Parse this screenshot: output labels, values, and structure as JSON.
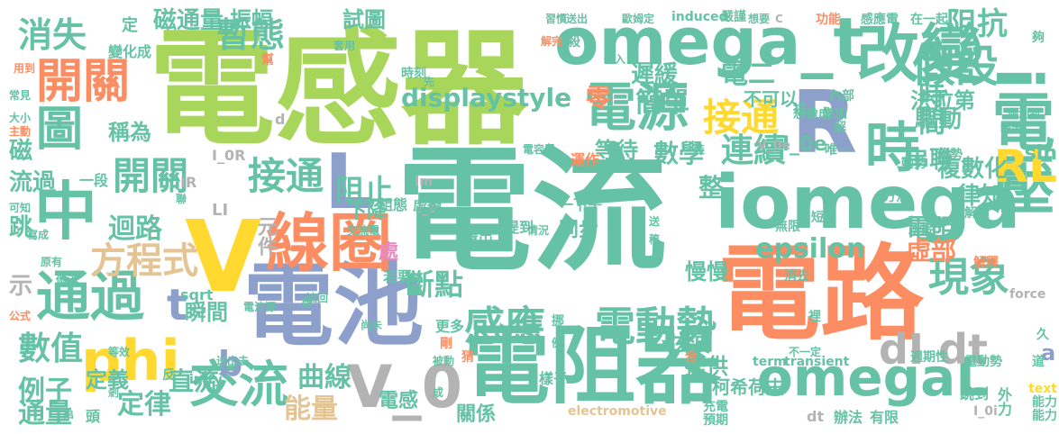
{
  "palette": {
    "green": "#a7d65a",
    "teal": "#66c2a5",
    "orange": "#fc8d62",
    "blue": "#8da0cb",
    "yellow": "#ffd92f",
    "tan": "#e5c494",
    "gray": "#b3b3b3",
    "pink": "#e78ac3"
  },
  "words": [
    {
      "text": "電感器",
      "color": "green"
    },
    {
      "text": "電流",
      "color": "teal"
    },
    {
      "text": "電路",
      "color": "orange"
    },
    {
      "text": "電池",
      "color": "blue"
    },
    {
      "text": "電阻器",
      "color": "teal"
    },
    {
      "text": "omega_t",
      "color": "teal"
    },
    {
      "text": "R",
      "color": "blue"
    },
    {
      "text": "V",
      "color": "yellow"
    },
    {
      "text": "iomega",
      "color": "teal"
    },
    {
      "text": "中",
      "color": "teal"
    },
    {
      "text": "線圈",
      "color": "orange"
    },
    {
      "text": "改變",
      "color": "teal"
    },
    {
      "text": "電源",
      "color": "teal"
    },
    {
      "text": "開關",
      "color": "orange"
    },
    {
      "text": "圖",
      "color": "teal"
    },
    {
      "text": "i電壓",
      "color": "teal"
    },
    {
      "text": "假設",
      "color": "teal"
    },
    {
      "text": "時",
      "color": "teal"
    },
    {
      "text": "omegaL",
      "color": "teal"
    },
    {
      "text": "V_0",
      "color": "gray"
    },
    {
      "text": "phi",
      "color": "yellow"
    },
    {
      "text": "通過",
      "color": "teal"
    },
    {
      "text": "交流",
      "color": "teal"
    },
    {
      "text": "感應",
      "color": "teal"
    },
    {
      "text": "電動勢",
      "color": "teal"
    },
    {
      "text": "現象",
      "color": "teal"
    },
    {
      "text": "開關",
      "color": "teal"
    },
    {
      "text": "接通",
      "color": "teal"
    },
    {
      "text": "接通",
      "color": "yellow"
    },
    {
      "text": "L",
      "color": "blue"
    },
    {
      "text": "方程式",
      "color": "tan"
    },
    {
      "text": "displaystyle",
      "color": "teal"
    },
    {
      "text": "暫態",
      "color": "teal"
    },
    {
      "text": "消失",
      "color": "teal"
    },
    {
      "text": "磁通量",
      "color": "teal"
    },
    {
      "text": "epsilon",
      "color": "teal"
    },
    {
      "text": "dI dt",
      "color": "gray"
    },
    {
      "text": "RL",
      "color": "yellow"
    },
    {
      "text": "阻抗",
      "color": "teal"
    },
    {
      "text": "數值",
      "color": "teal"
    },
    {
      "text": "例子",
      "color": "teal"
    },
    {
      "text": "定律",
      "color": "teal"
    },
    {
      "text": "曲線",
      "color": "teal"
    },
    {
      "text": "能量",
      "color": "tan"
    },
    {
      "text": "通量",
      "color": "teal"
    },
    {
      "text": "迴路",
      "color": "teal"
    },
    {
      "text": "阻止",
      "color": "teal"
    },
    {
      "text": "t",
      "color": "blue"
    },
    {
      "text": "b",
      "color": "blue"
    },
    {
      "text": "斷點",
      "color": "teal"
    },
    {
      "text": "連續",
      "color": "teal"
    },
    {
      "text": "時間",
      "color": "teal"
    },
    {
      "text": "電阻",
      "color": "teal"
    },
    {
      "text": "虛部",
      "color": "orange"
    },
    {
      "text": "串聯",
      "color": "teal"
    },
    {
      "text": "律知",
      "color": "teal"
    },
    {
      "text": "複數化",
      "color": "teal"
    },
    {
      "text": "簡單",
      "color": "teal"
    },
    {
      "text": "遲緩",
      "color": "teal"
    },
    {
      "text": "驅動",
      "color": "teal"
    },
    {
      "text": "法拉第",
      "color": "teal"
    },
    {
      "text": "數學",
      "color": "teal"
    },
    {
      "text": "等待",
      "color": "teal"
    },
    {
      "text": "慢慢",
      "color": "teal"
    },
    {
      "text": "弦波",
      "color": "teal"
    },
    {
      "text": "提供",
      "color": "teal"
    },
    {
      "text": "柯希荷夫",
      "color": "teal"
    },
    {
      "text": "關係",
      "color": "teal"
    },
    {
      "text": "直流",
      "color": "teal"
    },
    {
      "text": "瞬間",
      "color": "teal"
    },
    {
      "text": "定義",
      "color": "teal"
    },
    {
      "text": "振幅",
      "color": "teal"
    },
    {
      "text": "試圖",
      "color": "teal"
    },
    {
      "text": "整",
      "color": "teal"
    },
    {
      "text": "sin",
      "color": "teal"
    },
    {
      "text": "I_0e",
      "color": "teal"
    },
    {
      "text": "同步",
      "color": "teal"
    },
    {
      "text": "電感",
      "color": "teal"
    },
    {
      "text": "下降",
      "color": "teal"
    },
    {
      "text": "元件",
      "color": "gray"
    },
    {
      "text": "處",
      "color": "pink"
    },
    {
      "text": "電二",
      "color": "teal"
    },
    {
      "text": "不可以",
      "color": "teal"
    },
    {
      "text": "零",
      "color": "orange"
    },
    {
      "text": "sqrt",
      "color": "teal"
    },
    {
      "text": "infty",
      "color": "teal"
    },
    {
      "text": "transient",
      "color": "teal"
    },
    {
      "text": "term",
      "color": "teal"
    },
    {
      "text": "electromotive",
      "color": "tan"
    },
    {
      "text": "force",
      "color": "gray"
    },
    {
      "text": "induced",
      "color": "teal"
    },
    {
      "text": "嚴謹",
      "color": "teal"
    },
    {
      "text": "text",
      "color": "yellow"
    },
    {
      "text": "I_0R",
      "color": "gray"
    },
    {
      "text": "I_0i",
      "color": "gray"
    },
    {
      "text": "V_0e",
      "color": "gray"
    },
    {
      "text": "LI",
      "color": "gray"
    },
    {
      "text": "IR",
      "color": "gray"
    },
    {
      "text": "Im",
      "color": "gray"
    },
    {
      "text": "I_0",
      "color": "gray"
    },
    {
      "text": "dt",
      "color": "gray"
    },
    {
      "text": "a",
      "color": "blue"
    },
    {
      "text": "d",
      "color": "gray"
    },
    {
      "text": "變化成",
      "color": "teal"
    },
    {
      "text": "稱為",
      "color": "teal"
    },
    {
      "text": "磁",
      "color": "teal"
    },
    {
      "text": "流過",
      "color": "teal"
    },
    {
      "text": "跳",
      "color": "teal"
    },
    {
      "text": "示",
      "color": "gray"
    },
    {
      "text": "頭",
      "color": "teal"
    },
    {
      "text": "一段",
      "color": "teal"
    },
    {
      "text": "組態",
      "color": "teal"
    },
    {
      "text": "虛擬",
      "color": "teal"
    },
    {
      "text": "提到",
      "color": "teal"
    },
    {
      "text": "運作",
      "color": "orange"
    },
    {
      "text": "一下子",
      "color": "teal"
    },
    {
      "text": "畫出",
      "color": "teal"
    },
    {
      "text": "若要",
      "color": "teal"
    },
    {
      "text": "更多",
      "color": "teal"
    },
    {
      "text": "樣子",
      "color": "teal"
    },
    {
      "text": "充電",
      "color": "teal"
    },
    {
      "text": "預期",
      "color": "teal"
    },
    {
      "text": "辦法",
      "color": "teal"
    },
    {
      "text": "有限",
      "color": "teal"
    },
    {
      "text": "跳到",
      "color": "teal"
    },
    {
      "text": "外力",
      "color": "teal"
    },
    {
      "text": "週期性",
      "color": "teal"
    },
    {
      "text": "電動勢",
      "color": "teal"
    },
    {
      "text": "道",
      "color": "teal"
    },
    {
      "text": "能力",
      "color": "teal"
    },
    {
      "text": "所接",
      "color": "teal"
    },
    {
      "text": "解釋",
      "color": "orange"
    },
    {
      "text": "無限",
      "color": "teal"
    },
    {
      "text": "消去",
      "color": "teal"
    },
    {
      "text": "方法",
      "color": "teal"
    },
    {
      "text": "短暫",
      "color": "teal"
    },
    {
      "text": "解讀",
      "color": "teal"
    },
    {
      "text": "動勢",
      "color": "teal"
    },
    {
      "text": "唯一",
      "color": "teal"
    },
    {
      "text": "內部",
      "color": "teal"
    },
    {
      "text": "能力",
      "color": "teal"
    },
    {
      "text": "增加",
      "color": "teal"
    },
    {
      "text": "趨勢",
      "color": "teal"
    },
    {
      "text": "想像成",
      "color": "teal"
    },
    {
      "text": "倘測到",
      "color": "teal"
    },
    {
      "text": "斜率",
      "color": "teal"
    },
    {
      "text": "功能",
      "color": "orange"
    },
    {
      "text": "感應電",
      "color": "teal"
    },
    {
      "text": "在一起",
      "color": "teal"
    },
    {
      "text": "習慣",
      "color": "teal"
    },
    {
      "text": "送出",
      "color": "teal"
    },
    {
      "text": "歐姆定",
      "color": "teal"
    },
    {
      "text": "想要",
      "color": "teal"
    },
    {
      "text": "C",
      "color": "gray"
    },
    {
      "text": "殺",
      "color": "teal"
    },
    {
      "text": "夠",
      "color": "teal"
    },
    {
      "text": "用到",
      "color": "orange"
    },
    {
      "text": "常見",
      "color": "teal"
    },
    {
      "text": "大小",
      "color": "teal"
    },
    {
      "text": "主動",
      "color": "orange"
    },
    {
      "text": "可知",
      "color": "teal"
    },
    {
      "text": "寫成",
      "color": "teal"
    },
    {
      "text": "原有",
      "color": "teal"
    },
    {
      "text": "公式",
      "color": "orange"
    },
    {
      "text": "個正",
      "color": "teal"
    },
    {
      "text": "等效",
      "color": "teal"
    },
    {
      "text": "剎",
      "color": "teal"
    },
    {
      "text": "反",
      "color": "teal"
    },
    {
      "text": "送出去",
      "color": "teal"
    },
    {
      "text": "串",
      "color": "teal"
    },
    {
      "text": "交流電",
      "color": "teal"
    },
    {
      "text": "電流源",
      "color": "teal"
    },
    {
      "text": "流回",
      "color": "teal"
    },
    {
      "text": "尚未",
      "color": "teal"
    },
    {
      "text": "剛",
      "color": "orange"
    },
    {
      "text": "被動",
      "color": "teal"
    },
    {
      "text": "挪",
      "color": "teal"
    },
    {
      "text": "猜",
      "color": "orange"
    },
    {
      "text": "例",
      "color": "teal"
    },
    {
      "text": "裡",
      "color": "teal"
    },
    {
      "text": "不一定",
      "color": "teal"
    },
    {
      "text": "視",
      "color": "teal"
    },
    {
      "text": "久",
      "color": "teal"
    },
    {
      "text": "代入",
      "color": "teal"
    },
    {
      "text": "電容器",
      "color": "teal"
    },
    {
      "text": "情況",
      "color": "teal"
    },
    {
      "text": "解完",
      "color": "orange"
    },
    {
      "text": "幫",
      "color": "orange"
    },
    {
      "text": "先",
      "color": "teal"
    },
    {
      "text": "套用",
      "color": "teal"
    },
    {
      "text": "時刻",
      "color": "teal"
    },
    {
      "text": "定",
      "color": "teal"
    },
    {
      "text": "送",
      "color": "teal"
    },
    {
      "text": "稿",
      "color": "teal"
    },
    {
      "text": "想",
      "color": "teal"
    },
    {
      "text": "成",
      "color": "teal"
    },
    {
      "text": "合",
      "color": "orange"
    },
    {
      "text": "聯",
      "color": "teal"
    },
    {
      "text": "裝",
      "color": "teal"
    },
    {
      "text": "解",
      "color": "teal"
    }
  ]
}
